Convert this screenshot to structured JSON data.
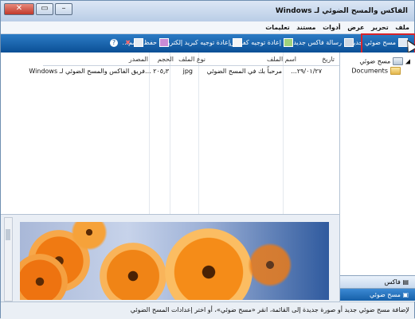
{
  "window": {
    "title": "الفاكس والمسح الضوئي لـ Windows",
    "close_label": "✕",
    "maximize_label": "▭",
    "minimize_label": "–"
  },
  "menubar": {
    "items": [
      "ملف",
      "تحرير",
      "عرض",
      "أدوات",
      "مستند",
      "تعليمات"
    ]
  },
  "toolbar": {
    "items": [
      {
        "label": "مسح ضوئي جديد",
        "icon": "scanner-icon"
      },
      {
        "label": "رسالة فاكس جديدة",
        "icon": "fax-icon"
      },
      {
        "label": "إعادة توجيه كفاكس",
        "icon": "forward-fax-icon"
      },
      {
        "label": "إعادة توجيه كبريد إلكتروني",
        "icon": "forward-email-icon"
      },
      {
        "label": "حفظ باسم...",
        "icon": "save-icon"
      }
    ],
    "print_icon": "printer-icon",
    "delete_icon": "delete-icon",
    "help_icon": "help-icon"
  },
  "nav": {
    "root_label": "مسح ضوئي",
    "child_label": "Documents",
    "fax_button": "فاكس",
    "scan_button": "مسح ضوئي"
  },
  "list": {
    "headers": [
      "تاريخ",
      "اسم الملف",
      "نوع الملف",
      "الحجم",
      "المصدر"
    ],
    "rows": [
      {
        "date": "٢٩/٠١/٢٧...",
        "filename": "مرحباً بك في المسح الضوئي",
        "type": "jpg",
        "size": "٢٠٥٫٣ ...",
        "source": "فريق الفاكس والمسح الضوئي لـ Windows"
      }
    ]
  },
  "status": {
    "text": "لإضافة مسح ضوئي جديد أو صورة جديدة إلى القائمة، انقر «مسح ضوئي»، أو اختر إعدادات المسح الضوئي"
  },
  "colors": {
    "toolbar": "#0b4f96",
    "highlight": "#d8232a",
    "flower": "#f28a1c"
  }
}
